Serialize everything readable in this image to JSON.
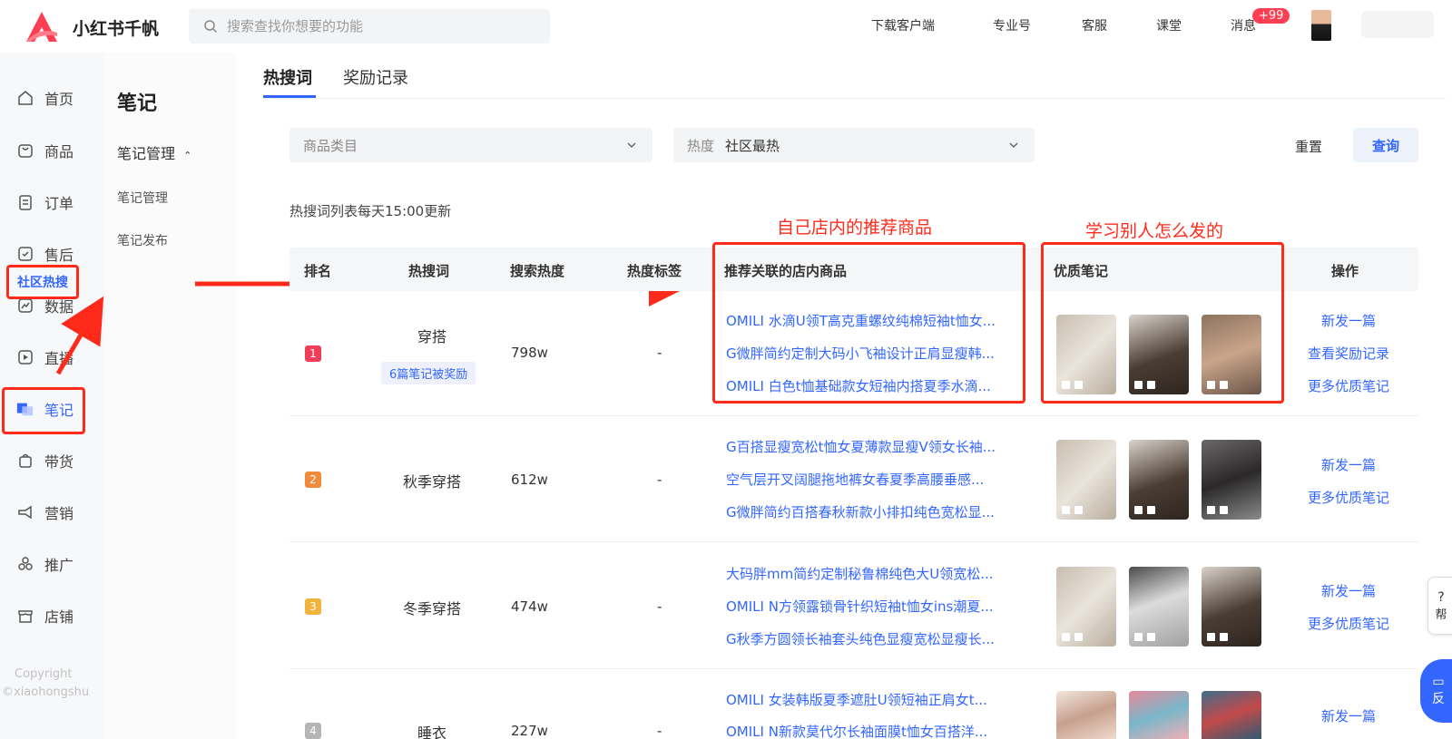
{
  "app": {
    "name": "小红书千帆"
  },
  "search": {
    "placeholder": "搜索查找你想要的功能"
  },
  "header_links": [
    "下载客户端",
    "专业号",
    "客服",
    "课堂",
    "消息"
  ],
  "message_badge": "+99",
  "left_nav": [
    "首页",
    "商品",
    "订单",
    "售后",
    "数据",
    "直播",
    "笔记",
    "带货",
    "营销",
    "推广",
    "店铺"
  ],
  "copyright": [
    "Copyright",
    "©xiaohongshu"
  ],
  "sub_nav": {
    "title": "笔记",
    "group": "笔记管理",
    "items": [
      "笔记管理",
      "笔记发布"
    ],
    "active": "社区热搜"
  },
  "tabs": [
    "热搜词",
    "奖励记录"
  ],
  "filters": {
    "category_placeholder": "商品类目",
    "heat_label": "热度",
    "heat_value": "社区最热",
    "reset": "重置",
    "query": "查询"
  },
  "update_note": "热搜词列表每天15:00更新",
  "annotations": {
    "products": "自己店内的推荐商品",
    "notes": "学习别人怎么发的"
  },
  "table": {
    "headers": [
      "排名",
      "热搜词",
      "搜索热度",
      "热度标签",
      "推荐关联的店内商品",
      "优质笔记",
      "操作"
    ],
    "rows": [
      {
        "rank": "1",
        "keyword": "穿搭",
        "badge": "6篇笔记被奖励",
        "heat": "798w",
        "tag": "-",
        "products": [
          "OMILI 水滴U领T高克重螺纹纯棉短袖t恤女...",
          "G微胖简约定制大码小飞袖设计正肩显瘦韩...",
          "OMILI 白色t恤基础款女短袖内搭夏季水滴..."
        ],
        "ops": [
          "新发一篇",
          "查看奖励记录",
          "更多优质笔记"
        ]
      },
      {
        "rank": "2",
        "keyword": "秋季穿搭",
        "heat": "612w",
        "tag": "-",
        "products": [
          "G百搭显瘦宽松t恤女夏薄款显瘦V领女长袖...",
          "空气层开叉阔腿拖地裤女春夏季高腰垂感...",
          "G微胖简约百搭春秋新款小排扣纯色宽松显..."
        ],
        "ops": [
          "新发一篇",
          "更多优质笔记"
        ]
      },
      {
        "rank": "3",
        "keyword": "冬季穿搭",
        "heat": "474w",
        "tag": "-",
        "products": [
          "大码胖mm简约定制秘鲁棉纯色大U领宽松...",
          "OMILI N方领露锁骨针织短袖t恤女ins潮夏...",
          "G秋季方圆领长袖套头纯色显瘦宽松显瘦长..."
        ],
        "ops": [
          "新发一篇",
          "更多优质笔记"
        ]
      },
      {
        "rank": "4",
        "keyword": "睡衣",
        "heat": "227w",
        "tag": "-",
        "products": [
          "OMILI 女装韩版夏季遮肚U领短袖正肩女t...",
          "OMILI N新款莫代尔长袖面膜t恤女百搭洋..."
        ],
        "ops": [
          "新发一篇"
        ]
      }
    ]
  },
  "widgets": {
    "help": "帮",
    "feedback": "反"
  },
  "colors": {
    "accent": "#3366ff",
    "annotation": "#ff2a1a"
  }
}
